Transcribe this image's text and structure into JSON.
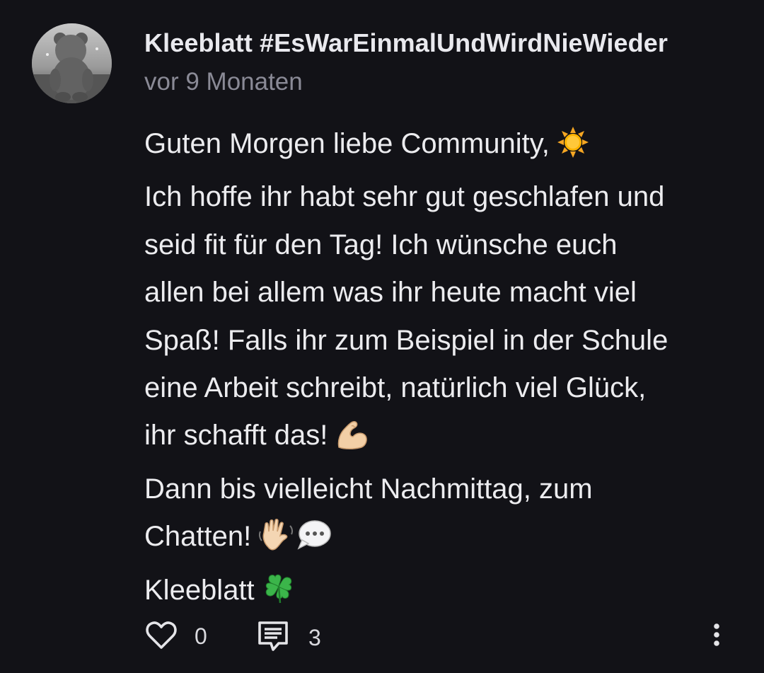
{
  "post": {
    "author": "Kleeblatt #EsWarEinmalUndWirdNieWieder",
    "timestamp": "vor 9 Monaten",
    "avatar_icon": "teddy-bear-avatar",
    "lines": [
      "Guten Morgen liebe Community,",
      "Ich hoffe ihr habt sehr gut geschlafen und",
      "seid fit für den Tag! Ich wünsche euch",
      "allen bei allem was ihr heute macht viel",
      "Spaß! Falls ihr zum Beispiel in der Schule",
      "eine Arbeit schreibt, natürlich viel Glück,",
      "ihr schafft das!",
      "Dann bis vielleicht Nachmittag, zum",
      "Chatten!",
      "Kleeblatt"
    ],
    "emojis": {
      "sun": "sun-emoji",
      "muscle": "flexed-biceps-emoji",
      "wave": "waving-hand-emoji",
      "speech": "speech-bubble-emoji",
      "clover": "four-leaf-clover-emoji"
    }
  },
  "actions": {
    "like_icon": "heart-outline-icon",
    "like_count": "0",
    "comment_icon": "comment-icon",
    "comment_count": "3",
    "more_icon": "more-vertical-icon"
  },
  "colors": {
    "background": "#121217",
    "text": "#ececef",
    "muted": "#8a8a96"
  }
}
